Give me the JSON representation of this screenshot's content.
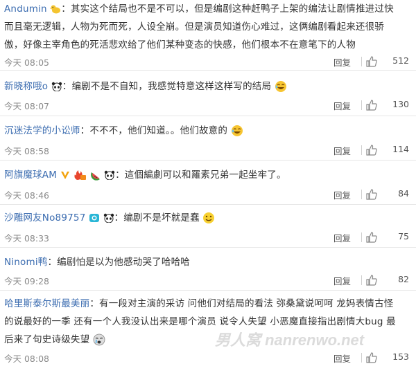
{
  "comments": [
    {
      "user": "Andumin",
      "badge": "duck-badge",
      "lines": [
        "其实这个结局也不是不可以，但是编剧这种赶鸭子上架的编法让剧情推进过快",
        "而且毫无逻辑，人物为死而死，人设全崩。但是演员知道伤心难过，这俩编剧看起来还很骄",
        "傲，好像主宰角色的死活悲欢给了他们某种变态的快感，他们根本不在意笔下的人物"
      ],
      "time": "今天 08:05",
      "reply": "回复",
      "likes": "512"
    },
    {
      "user": "新晓称哦o",
      "badge": "panda-badge",
      "lines": [
        "编剧不是不自知，我感觉特意这样这样写的结局"
      ],
      "time": "今天 08:07",
      "reply": "回复",
      "likes": "130"
    },
    {
      "user": "沉迷法学的小讼师",
      "badge": "",
      "lines": [
        "不不不，他们知道。。他们故意的"
      ],
      "time": "今天 08:58",
      "reply": "回复",
      "likes": "114"
    },
    {
      "user": "阿旗魔球AM",
      "badge": "v-badge",
      "lines": [
        "這個編劇可以和羅素兄弟一起坐牢了。"
      ],
      "time": "今天 08:46",
      "reply": "回复",
      "likes": "84"
    },
    {
      "user": "沙雕网友No89757",
      "badge": "camera-badge",
      "lines": [
        "编剧不是坏就是蠢"
      ],
      "time": "今天 08:33",
      "reply": "回复",
      "likes": "75"
    },
    {
      "user": "Ninomi鸭",
      "badge": "",
      "lines": [
        "编剧怕是以为他感动哭了哈哈哈"
      ],
      "time": "今天 09:28",
      "reply": "回复",
      "likes": "82"
    },
    {
      "user": "哈里斯泰尔斯最美丽",
      "badge": "",
      "lines": [
        "有一段对主演的采访 问他们对结局的看法 弥桑黛说呵呵 龙妈表情古怪",
        "的说最好的一季 还有一个人我没认出来是哪个演员 说令人失望 小恶魔直接指出剧情大bug 最",
        "后来了句史诗级失望"
      ],
      "time": "今天 08:08",
      "reply": "回复",
      "likes": "153"
    }
  ],
  "watermark": "男人窝 nanrenwo.net",
  "colors": {
    "username": "#3b6cb0",
    "meta": "#8a8a8a",
    "divider": "#e6e6e6"
  }
}
